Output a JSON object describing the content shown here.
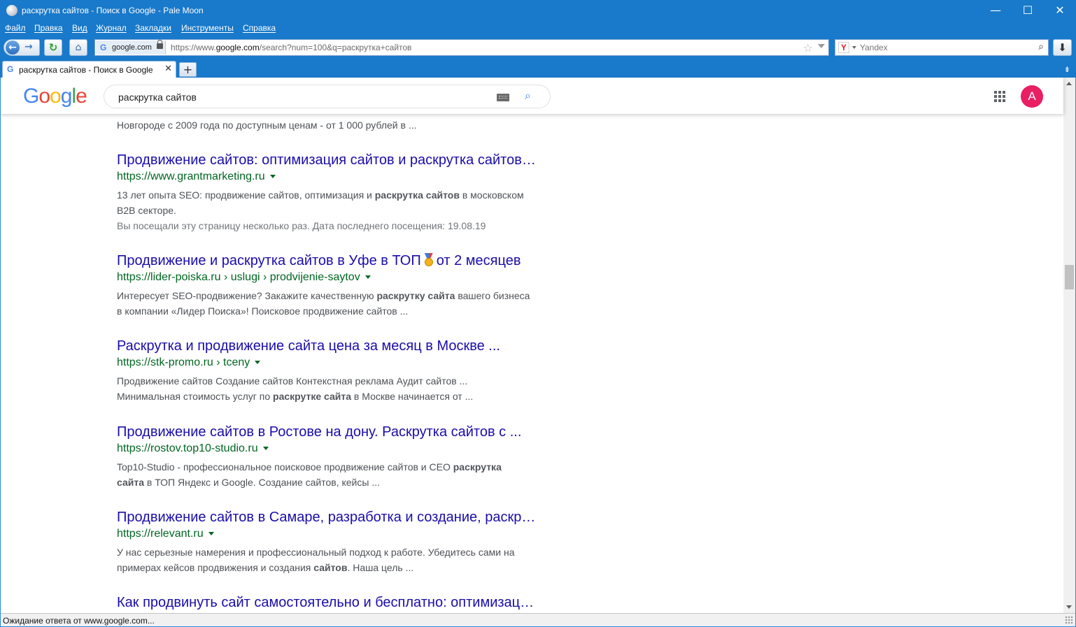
{
  "window": {
    "title": "раскрутка сайтов - Поиск в Google - Pale Moon",
    "minimize": "—",
    "maximize": "☐",
    "close": "✕"
  },
  "menu": [
    "Файл",
    "Правка",
    "Вид",
    "Журнал",
    "Закладки",
    "Инструменты",
    "Справка"
  ],
  "toolbar": {
    "identity_domain": "google.com",
    "url_prefix": "https://www.",
    "url_domain": "google.com",
    "url_suffix": "/search?num=100&q=раскрутка+сайтов",
    "search_engine": "Yandex",
    "search_engine_icon": "Y"
  },
  "tabs": [
    {
      "label": "раскрутка сайтов - Поиск в Google",
      "active": true
    }
  ],
  "google": {
    "logo": [
      "G",
      "o",
      "o",
      "g",
      "l",
      "e"
    ],
    "logo_colors": [
      "#4285f4",
      "#ea4335",
      "#fbbc05",
      "#4285f4",
      "#34a853",
      "#ea4335"
    ],
    "query": "раскрутка сайтов",
    "avatar_letter": "A",
    "avatar_color": "#e91e63"
  },
  "results_top_snippet": "Новгороде с 2009 года по доступным ценам - от 1 000 рублей в ...",
  "results": [
    {
      "title": "Продвижение сайтов: оптимизация сайтов и раскрутка сайтов…",
      "url": "https://www.grantmarketing.ru",
      "snippet": [
        [
          {
            "t": "13 лет опыта SEO: продвижение сайтов, оптимизация и "
          },
          {
            "t": "раскрутка сайтов",
            "b": true
          },
          {
            "t": " в московском"
          }
        ],
        [
          {
            "t": "B2B секторе."
          }
        ]
      ],
      "visited": "Вы посещали эту страницу несколько раз. Дата последнего посещения: 19.08.19"
    },
    {
      "title_before": "Продвижение и раскрутка сайтов в Уфе в ТОП",
      "title_after": "от 2 месяцев",
      "has_medal": true,
      "url": "https://lider-poiska.ru › uslugi › prodvijenie-saytov",
      "snippet": [
        [
          {
            "t": "Интересует SEO-продвижение? Закажите качественную "
          },
          {
            "t": "раскрутку сайта",
            "b": true
          },
          {
            "t": " вашего бизнеса"
          }
        ],
        [
          {
            "t": "в компании «Лидер Поиска»! Поисковое продвижение сайтов ..."
          }
        ]
      ]
    },
    {
      "title": "Раскрутка и продвижение сайта цена за месяц в Москве ...",
      "url": "https://stk-promo.ru › tceny",
      "snippet": [
        [
          {
            "t": "Продвижение сайтов Создание сайтов Контекстная реклама Аудит сайтов ..."
          }
        ],
        [
          {
            "t": "Минимальная стоимость услуг по "
          },
          {
            "t": "раскрутке сайта",
            "b": true
          },
          {
            "t": " в Москве начинается от ..."
          }
        ]
      ]
    },
    {
      "title": "Продвижение сайтов в Ростове на дону. Раскрутка сайтов с ...",
      "url": "https://rostov.top10-studio.ru",
      "snippet": [
        [
          {
            "t": "Top10-Studio - профессиональное поисковое продвижение сайтов и СЕО "
          },
          {
            "t": "раскрутка",
            "b": true
          }
        ],
        [
          {
            "t": "сайта",
            "b": true
          },
          {
            "t": " в ТОП Яндекс и Google. Создание сайтов, кейсы ..."
          }
        ]
      ]
    },
    {
      "title": "Продвижение сайтов в Самаре, разработка и создание, раскр…",
      "url": "https://relevant.ru",
      "snippet": [
        [
          {
            "t": "У нас серьезные намерения и профессиональный подход к работе. Убедитесь сами на"
          }
        ],
        [
          {
            "t": "примерах кейсов продвижения и создания "
          },
          {
            "t": "сайтов",
            "b": true
          },
          {
            "t": ". Наша цель ..."
          }
        ]
      ]
    },
    {
      "title": "Как продвинуть сайт самостоятельно и бесплатно: оптимизац…"
    }
  ],
  "status": "Ожидание ответа от www.google.com..."
}
